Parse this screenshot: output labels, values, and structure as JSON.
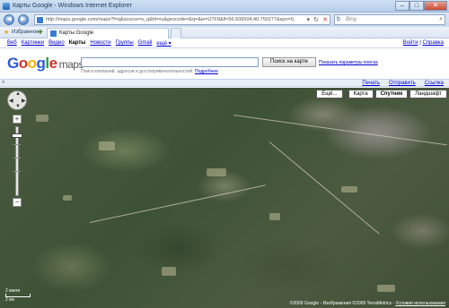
{
  "window": {
    "title": "Карты Google - Windows Internet Explorer"
  },
  "address": {
    "url": "http://maps.google.com/maps?f=q&source=s_q&hl=ru&geocode=&q=&ie=UTF8&ll=56.836504,40.750277&spn=0,",
    "search_placeholder": "Bing"
  },
  "favorites": {
    "label": "Избранное",
    "tab_label": "Карты Google"
  },
  "gbar": {
    "links": [
      "Веб",
      "Картинки",
      "Видео",
      "Карты",
      "Новости",
      "Группы",
      "Gmail",
      "ещё ▾"
    ],
    "active": "Карты",
    "login": "Войти",
    "help": "Справка"
  },
  "search": {
    "button": "Поиск на карте",
    "show_options": "Показать параметры поиска",
    "hint": "Поиск компаний, адресов и достопримечательностей.",
    "hint_link": "Подробнее"
  },
  "linkbar": {
    "print": "Печать",
    "send": "Отправить",
    "link": "Ссылка"
  },
  "map": {
    "types": {
      "more": "Ещё...",
      "map": "Карта",
      "satellite": "Спутник",
      "terrain": "Ландшафт"
    },
    "selected_type": "Спутник",
    "scale_top": "2 мили",
    "scale_bottom": "2 км",
    "copyright": "©2009 Google - Изображения ©2009 TerraMetrics -",
    "terms": "Условия использования"
  }
}
